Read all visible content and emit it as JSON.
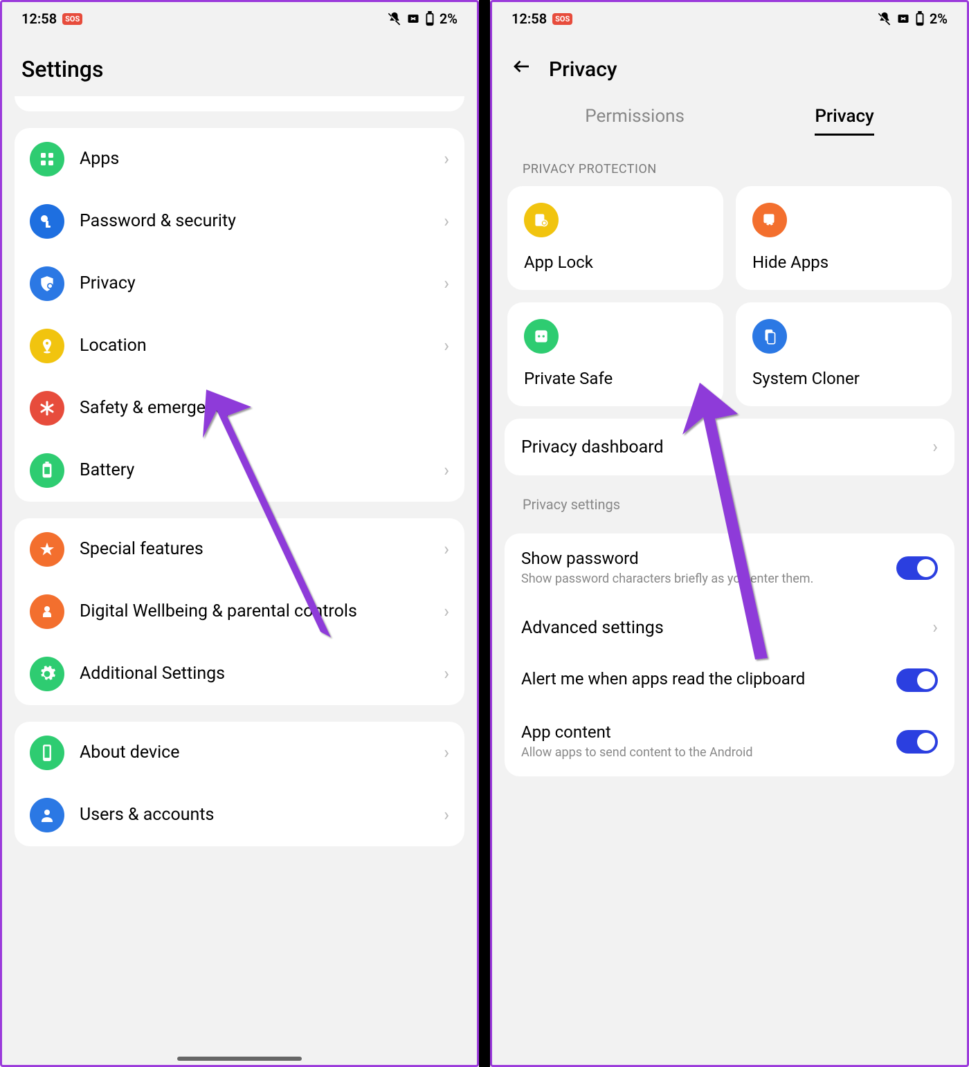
{
  "status": {
    "time": "12:58",
    "sos": "SOS",
    "battery": "2%"
  },
  "left": {
    "title": "Settings",
    "group1": [
      {
        "label": "Apps",
        "color": "green",
        "icon": "apps"
      },
      {
        "label": "Password & security",
        "color": "blue",
        "icon": "key"
      },
      {
        "label": "Privacy",
        "color": "blue2",
        "icon": "shield"
      },
      {
        "label": "Location",
        "color": "yellow",
        "icon": "pin"
      },
      {
        "label": "Safety & emergency",
        "color": "red",
        "icon": "asterisk"
      },
      {
        "label": "Battery",
        "color": "green",
        "icon": "battery"
      }
    ],
    "group2": [
      {
        "label": "Special features",
        "color": "orange",
        "icon": "star"
      },
      {
        "label": "Digital Wellbeing & parental controls",
        "color": "orange",
        "icon": "heart"
      },
      {
        "label": "Additional Settings",
        "color": "green",
        "icon": "gear"
      }
    ],
    "group3": [
      {
        "label": "About device",
        "color": "green",
        "icon": "device"
      },
      {
        "label": "Users & accounts",
        "color": "blue2",
        "icon": "user"
      }
    ]
  },
  "right": {
    "title": "Privacy",
    "tabs": {
      "a": "Permissions",
      "b": "Privacy"
    },
    "section1_header": "PRIVACY PROTECTION",
    "tiles": [
      {
        "label": "App Lock",
        "color": "yellow",
        "icon": "applock"
      },
      {
        "label": "Hide Apps",
        "color": "orange",
        "icon": "hide"
      },
      {
        "label": "Private Safe",
        "color": "green",
        "icon": "safe"
      },
      {
        "label": "System Cloner",
        "color": "blue2",
        "icon": "clone"
      }
    ],
    "dashboard": "Privacy dashboard",
    "section2_header": "Privacy settings",
    "show_pw": {
      "title": "Show password",
      "sub": "Show password characters briefly as you enter them."
    },
    "advanced": "Advanced settings",
    "alert_clip": {
      "title": "Alert me when apps read the clipboard"
    },
    "app_content": {
      "title": "App content",
      "sub": "Allow apps to send content to the Android"
    }
  }
}
